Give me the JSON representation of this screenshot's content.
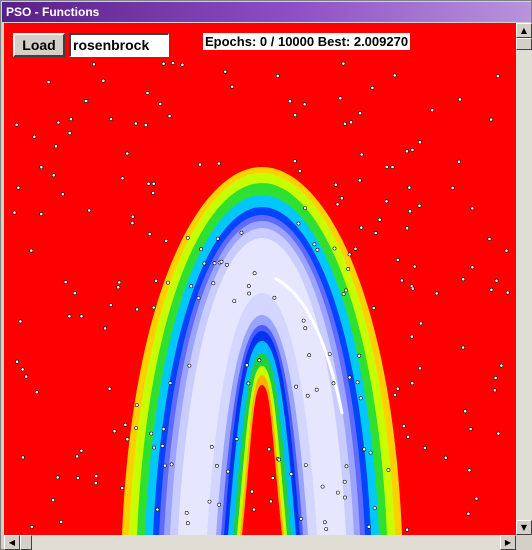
{
  "window": {
    "title": "PSO - Functions"
  },
  "toolbar": {
    "load_label": "Load",
    "function_value": "rosenbrock"
  },
  "status": {
    "text": "Epochs: 0 / 10000   Best: 2.009270"
  },
  "colors": {
    "background": "#ff0000",
    "title_start": "#5a1f86",
    "title_end": "#b894dc"
  },
  "icons": {
    "scroll_up": "arrow-up-icon",
    "scroll_down": "arrow-down-icon",
    "scroll_left": "arrow-left-icon",
    "scroll_right": "arrow-right-icon"
  }
}
